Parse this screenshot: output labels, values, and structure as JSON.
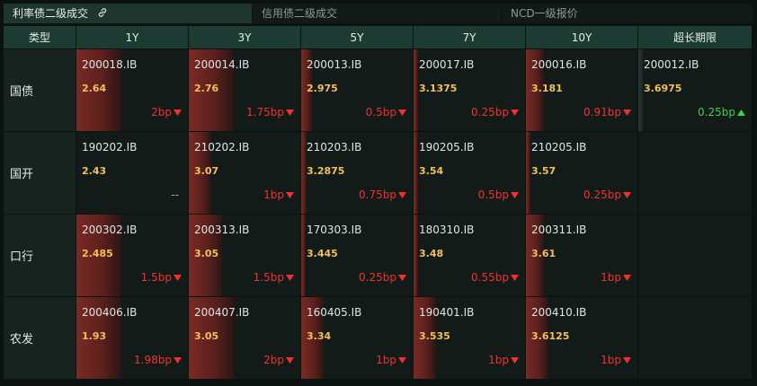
{
  "tabs": [
    {
      "label": "利率债二级成交",
      "active": true
    },
    {
      "label": "信用债二级成交",
      "active": false
    },
    {
      "label": "NCD一级报价",
      "active": false
    }
  ],
  "columns": [
    "类型",
    "1Y",
    "3Y",
    "5Y",
    "7Y",
    "10Y",
    "超长期限"
  ],
  "colors": {
    "down": "#f23030",
    "up": "#3fd14a",
    "rate": "#f2c05a",
    "header": "#1d3a33"
  },
  "rows": [
    {
      "label": "国债",
      "cells": [
        {
          "code": "200018.IB",
          "rate": "2.64",
          "change": "2bp",
          "dir": "down",
          "intensity": 0.4
        },
        {
          "code": "200014.IB",
          "rate": "2.76",
          "change": "1.75bp",
          "dir": "down",
          "intensity": 0.4
        },
        {
          "code": "200013.IB",
          "rate": "2.975",
          "change": "0.5bp",
          "dir": "down",
          "intensity": 0.1
        },
        {
          "code": "200017.IB",
          "rate": "3.1375",
          "change": "0.25bp",
          "dir": "down",
          "intensity": 0.04
        },
        {
          "code": "200016.IB",
          "rate": "3.181",
          "change": "0.91bp",
          "dir": "down",
          "intensity": 0.16
        },
        {
          "code": "200012.IB",
          "rate": "3.6975",
          "change": "0.25bp",
          "dir": "up",
          "intensity": 0.04
        }
      ]
    },
    {
      "label": "国开",
      "cells": [
        {
          "code": "190202.IB",
          "rate": "2.43",
          "change": "--",
          "dir": "flat",
          "intensity": 0
        },
        {
          "code": "210202.IB",
          "rate": "3.07",
          "change": "1bp",
          "dir": "down",
          "intensity": 0.2
        },
        {
          "code": "210203.IB",
          "rate": "3.2875",
          "change": "0.75bp",
          "dir": "down",
          "intensity": 0.05
        },
        {
          "code": "190205.IB",
          "rate": "3.54",
          "change": "0.5bp",
          "dir": "down",
          "intensity": 0.04
        },
        {
          "code": "210205.IB",
          "rate": "3.57",
          "change": "0.25bp",
          "dir": "down",
          "intensity": 0.04
        },
        null
      ]
    },
    {
      "label": "口行",
      "cells": [
        {
          "code": "200302.IB",
          "rate": "2.485",
          "change": "1.5bp",
          "dir": "down",
          "intensity": 0.4
        },
        {
          "code": "200313.IB",
          "rate": "3.05",
          "change": "1.5bp",
          "dir": "down",
          "intensity": 0.3
        },
        {
          "code": "170303.IB",
          "rate": "3.445",
          "change": "0.25bp",
          "dir": "down",
          "intensity": 0.04
        },
        {
          "code": "180310.IB",
          "rate": "3.48",
          "change": "0.55bp",
          "dir": "down",
          "intensity": 0.04
        },
        {
          "code": "200311.IB",
          "rate": "3.61",
          "change": "1bp",
          "dir": "down",
          "intensity": 0.16
        },
        null
      ]
    },
    {
      "label": "农发",
      "cells": [
        {
          "code": "200406.IB",
          "rate": "1.93",
          "change": "1.98bp",
          "dir": "down",
          "intensity": 0.4
        },
        {
          "code": "200407.IB",
          "rate": "3.05",
          "change": "2bp",
          "dir": "down",
          "intensity": 0.4
        },
        {
          "code": "160405.IB",
          "rate": "3.34",
          "change": "1bp",
          "dir": "down",
          "intensity": 0.2
        },
        {
          "code": "190401.IB",
          "rate": "3.535",
          "change": "1bp",
          "dir": "down",
          "intensity": 0.2
        },
        {
          "code": "200410.IB",
          "rate": "3.6125",
          "change": "1bp",
          "dir": "down",
          "intensity": 0.2
        },
        null
      ]
    }
  ]
}
